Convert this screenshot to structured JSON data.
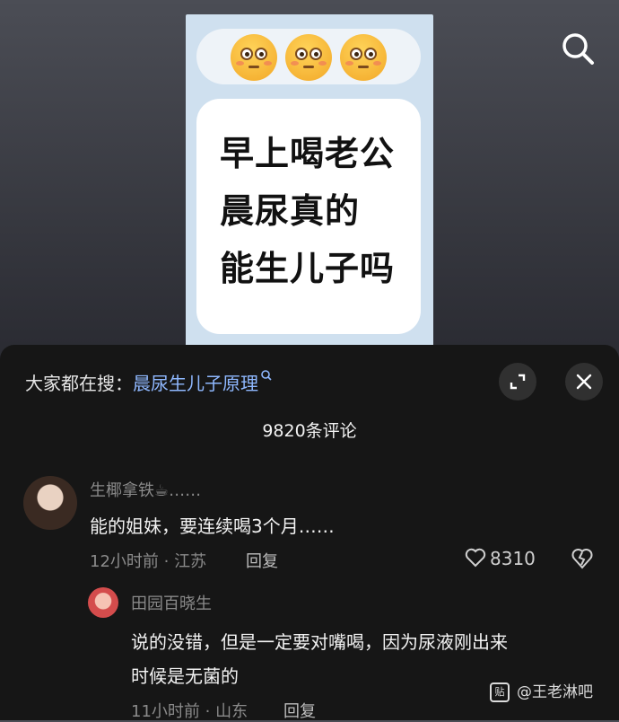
{
  "post": {
    "emoji_icons": [
      "flushed-face-icon",
      "flushed-face-icon",
      "flushed-face-icon"
    ],
    "lines": [
      "早上喝老公",
      "晨尿真的",
      "能生儿子吗"
    ]
  },
  "search_bar": {
    "prefix": "大家都在搜：",
    "query": "晨尿生儿子原理",
    "query_icon": "search-icon"
  },
  "comments_header": {
    "count_text": "9820条评论"
  },
  "comment1": {
    "username": "生椰拿铁☕……",
    "text": "能的姐妹，要连续喝3个月……",
    "meta": "12小时前 · 江苏",
    "reply_label": "回复",
    "likes": "8310"
  },
  "reply1": {
    "username": "田园百晓生",
    "text_line1": "说的没错，但是一定要对嘴喝，因为尿液刚出来",
    "text_line2": "时候是无菌的",
    "meta": "11小时前 · 山东",
    "reply_label": "回复"
  },
  "watermark": {
    "logo_text": "贴",
    "text": "@王老淋吧"
  },
  "colors": {
    "panel_bg": "#161616",
    "link": "#8fb8ff",
    "card_bg": "#cfe0ef"
  }
}
